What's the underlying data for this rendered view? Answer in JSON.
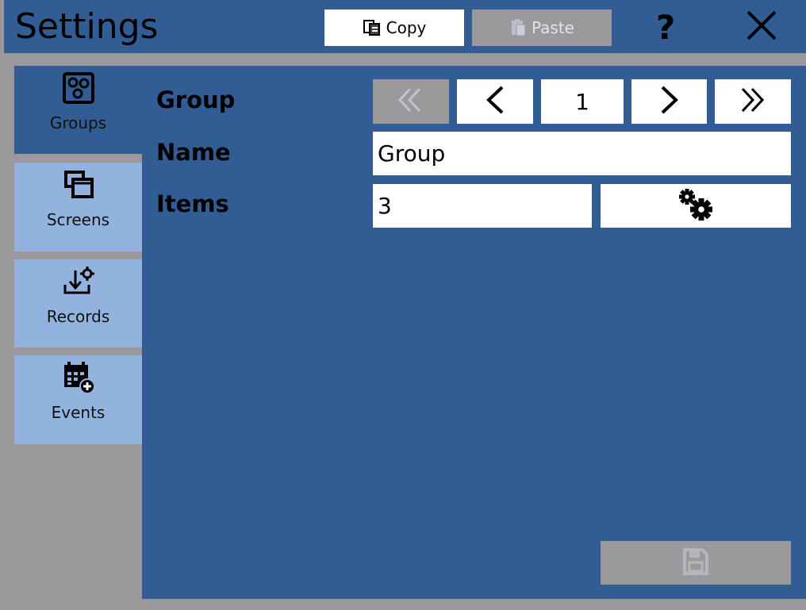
{
  "window": {
    "title": "Settings",
    "copy_label": "Copy",
    "paste_label": "Paste",
    "help_label": "?"
  },
  "sidebar": {
    "items": [
      {
        "label": "Groups",
        "icon": "groups-icon",
        "active": true
      },
      {
        "label": "Screens",
        "icon": "screens-icon",
        "active": false
      },
      {
        "label": "Records",
        "icon": "records-icon",
        "active": false
      },
      {
        "label": "Events",
        "icon": "events-icon",
        "active": false
      }
    ]
  },
  "form": {
    "group_label": "Group",
    "name_label": "Name",
    "items_label": "Items",
    "page_number": "1",
    "name_value": "Group",
    "items_value": "3"
  },
  "colors": {
    "primary": "#325d94",
    "sidebar_inactive": "#93b3df",
    "disabled": "#9b999b",
    "background": "#9b999b"
  }
}
